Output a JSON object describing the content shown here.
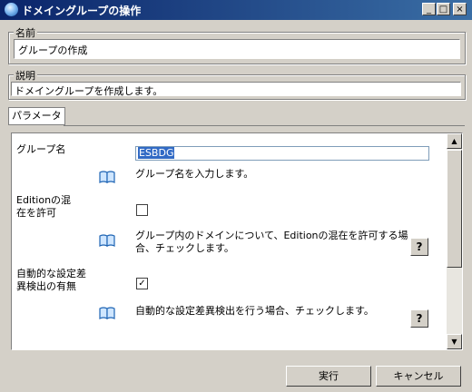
{
  "window": {
    "title": "ドメイングループの操作",
    "min_glyph": "_",
    "max_glyph": "□",
    "close_glyph": "×"
  },
  "name_group": {
    "legend": "名前",
    "value": "グループの作成"
  },
  "desc_group": {
    "legend": "説明",
    "value": "ドメイングループを作成します。"
  },
  "tab": {
    "label": "パラメータ"
  },
  "params": {
    "group_name": {
      "label": "グループ名",
      "value": "ESBDG",
      "help": "グループ名を入力します。"
    },
    "edition": {
      "label_line1": "Editionの混",
      "label_line2": "在を許可",
      "checked_glyph": "",
      "help_line1": "グループ内のドメインについて、Editionの混在を許可する場",
      "help_line2": "合、チェックします。",
      "help_button": "?"
    },
    "auto_detect": {
      "label_line1": "自動的な設定差",
      "label_line2": "異検出の有無",
      "checked_glyph": "✓",
      "help": "自動的な設定差異検出を行う場合、チェックします。",
      "help_button": "?"
    }
  },
  "scroll": {
    "up": "▲",
    "down": "▼"
  },
  "buttons": {
    "execute": "実行",
    "cancel": "キャンセル"
  }
}
